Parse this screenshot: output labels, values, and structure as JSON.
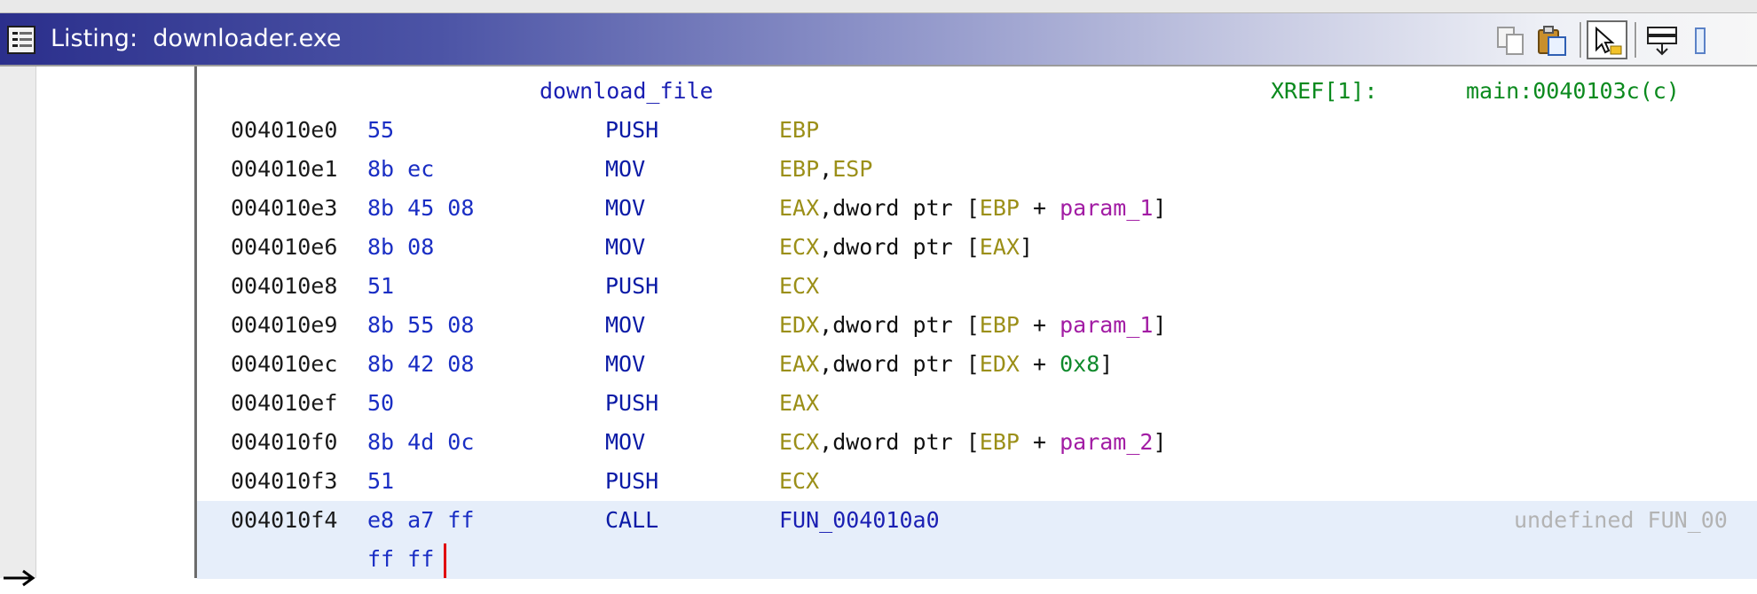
{
  "window": {
    "title_prefix": "Listing:",
    "title_file": "downloader.exe",
    "toolbar": [
      "copy-icon",
      "paste-icon",
      "cursor-select-icon",
      "navigation-icon"
    ]
  },
  "colors": {
    "titlebar_start": "#2b2f8c",
    "selected_row": "#e6eefa",
    "address": "#1a1a1a",
    "bytes": "#1a2ec4",
    "mnemonic": "#0a1aa6",
    "register": "#9b8f18",
    "parameter": "#a21ca4",
    "constant": "#0f8a2c",
    "xref": "#0b8a1e",
    "cursor": "#e00000"
  },
  "function_header": {
    "name": "download_file",
    "xref_label": "XREF[1]:",
    "xref_target": "main:0040103c(c)"
  },
  "rows": [
    {
      "address": "004010e0",
      "bytes": "55",
      "mnemonic": "PUSH",
      "operands": [
        {
          "text": "EBP",
          "kind": "reg"
        }
      ]
    },
    {
      "address": "004010e1",
      "bytes": "8b ec",
      "mnemonic": "MOV",
      "operands": [
        {
          "text": "EBP",
          "kind": "reg"
        },
        {
          "text": ",",
          "kind": "plain"
        },
        {
          "text": "ESP",
          "kind": "reg"
        }
      ]
    },
    {
      "address": "004010e3",
      "bytes": "8b 45 08",
      "mnemonic": "MOV",
      "operands": [
        {
          "text": "EAX",
          "kind": "reg"
        },
        {
          "text": ",dword ptr [",
          "kind": "plain"
        },
        {
          "text": "EBP",
          "kind": "reg"
        },
        {
          "text": " + ",
          "kind": "plain"
        },
        {
          "text": "param_1",
          "kind": "param"
        },
        {
          "text": "]",
          "kind": "plain"
        }
      ]
    },
    {
      "address": "004010e6",
      "bytes": "8b 08",
      "mnemonic": "MOV",
      "operands": [
        {
          "text": "ECX",
          "kind": "reg"
        },
        {
          "text": ",dword ptr [",
          "kind": "plain"
        },
        {
          "text": "EAX",
          "kind": "reg"
        },
        {
          "text": "]",
          "kind": "plain"
        }
      ]
    },
    {
      "address": "004010e8",
      "bytes": "51",
      "mnemonic": "PUSH",
      "operands": [
        {
          "text": "ECX",
          "kind": "reg"
        }
      ]
    },
    {
      "address": "004010e9",
      "bytes": "8b 55 08",
      "mnemonic": "MOV",
      "operands": [
        {
          "text": "EDX",
          "kind": "reg"
        },
        {
          "text": ",dword ptr [",
          "kind": "plain"
        },
        {
          "text": "EBP",
          "kind": "reg"
        },
        {
          "text": " + ",
          "kind": "plain"
        },
        {
          "text": "param_1",
          "kind": "param"
        },
        {
          "text": "]",
          "kind": "plain"
        }
      ]
    },
    {
      "address": "004010ec",
      "bytes": "8b 42 08",
      "mnemonic": "MOV",
      "operands": [
        {
          "text": "EAX",
          "kind": "reg"
        },
        {
          "text": ",dword ptr [",
          "kind": "plain"
        },
        {
          "text": "EDX",
          "kind": "reg"
        },
        {
          "text": " + ",
          "kind": "plain"
        },
        {
          "text": "0x8",
          "kind": "num"
        },
        {
          "text": "]",
          "kind": "plain"
        }
      ]
    },
    {
      "address": "004010ef",
      "bytes": "50",
      "mnemonic": "PUSH",
      "operands": [
        {
          "text": "EAX",
          "kind": "reg"
        }
      ]
    },
    {
      "address": "004010f0",
      "bytes": "8b 4d 0c",
      "mnemonic": "MOV",
      "operands": [
        {
          "text": "ECX",
          "kind": "reg"
        },
        {
          "text": ",dword ptr [",
          "kind": "plain"
        },
        {
          "text": "EBP",
          "kind": "reg"
        },
        {
          "text": " + ",
          "kind": "plain"
        },
        {
          "text": "param_2",
          "kind": "param"
        },
        {
          "text": "]",
          "kind": "plain"
        }
      ]
    },
    {
      "address": "004010f3",
      "bytes": "51",
      "mnemonic": "PUSH",
      "operands": [
        {
          "text": "ECX",
          "kind": "reg"
        }
      ]
    },
    {
      "address": "004010f4",
      "bytes": "e8 a7 ff",
      "mnemonic": "CALL",
      "operands": [
        {
          "text": "FUN_004010a0",
          "kind": "label"
        }
      ],
      "hint": "undefined FUN_00",
      "selected": true
    },
    {
      "address": "",
      "bytes": "ff ff",
      "mnemonic": "",
      "operands": [],
      "selected": true
    }
  ]
}
